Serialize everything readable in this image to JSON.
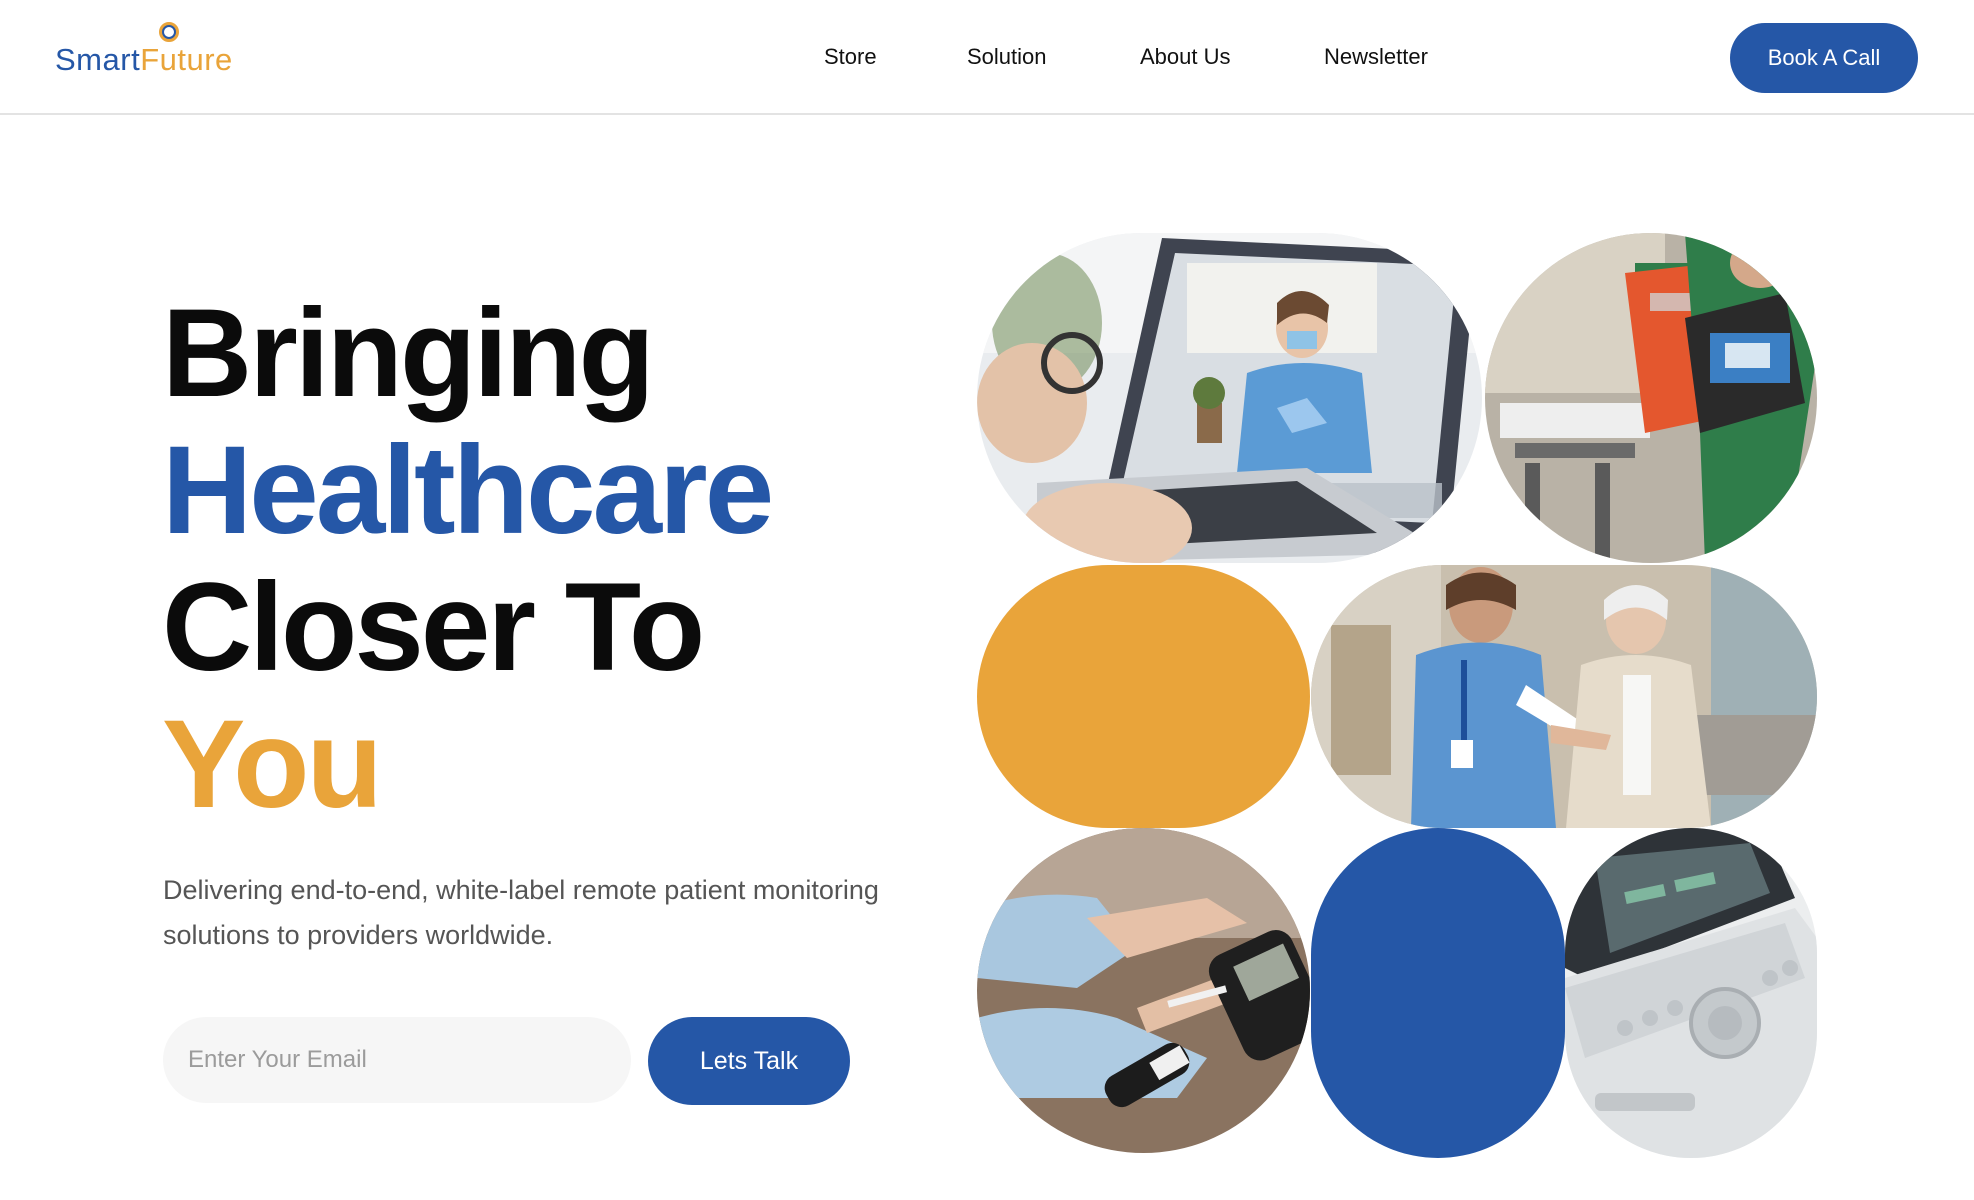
{
  "brand": {
    "part1": "Smart",
    "part2": "Future",
    "colors": {
      "blue": "#2557a7",
      "orange": "#e9a43a"
    }
  },
  "nav": {
    "items": [
      {
        "label": "Store"
      },
      {
        "label": "Solution"
      },
      {
        "label": "About Us"
      },
      {
        "label": "Newsletter"
      }
    ],
    "cta": "Book A Call"
  },
  "hero": {
    "headline": [
      "Bringing",
      "Healthcare",
      "Closer To",
      "You"
    ],
    "subtitle": "Delivering end-to-end, white-label remote patient monitoring solutions to providers worldwide.",
    "email_placeholder": "Enter Your Email",
    "email_value": "",
    "button": "Lets Talk"
  },
  "gallery": {
    "images": [
      {
        "name": "telehealth-laptop-photo"
      },
      {
        "name": "paramedic-equipment-photo"
      },
      {
        "name": "nurse-assisting-elderly-photo"
      },
      {
        "name": "glucose-meter-test-photo"
      },
      {
        "name": "ultrasound-machine-photo"
      }
    ],
    "accent_colors": [
      "#e9a43a",
      "#2557a7"
    ]
  }
}
